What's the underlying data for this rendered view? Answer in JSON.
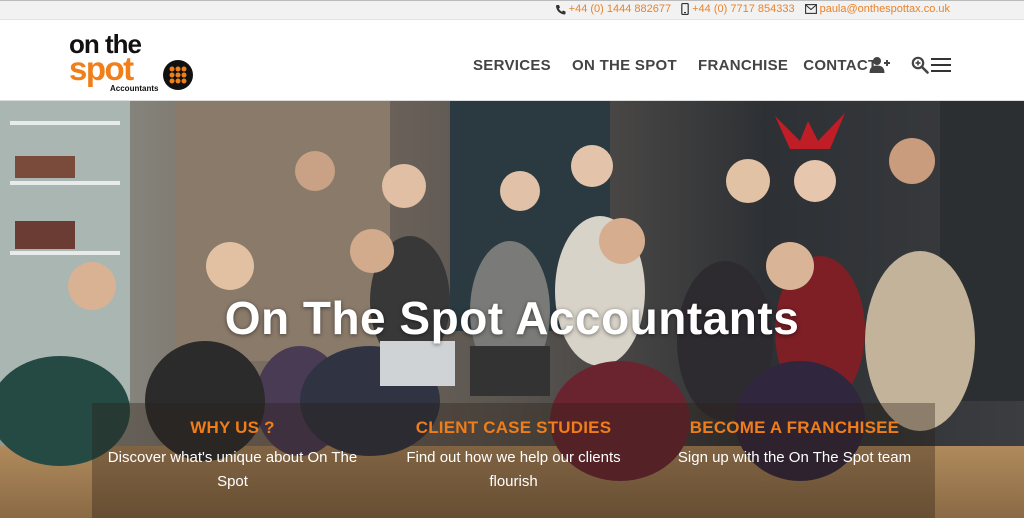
{
  "topbar": {
    "phone1": "+44 (0) 1444 882677",
    "phone2": "+44 (0) 7717 854333",
    "email": "paula@onthespottax.co.uk",
    "accent": "#e8832a"
  },
  "logo": {
    "line1": "on the",
    "line2": "spot",
    "line3": "Accountants",
    "brand_orange": "#f07f1a"
  },
  "nav": {
    "items": [
      "SERVICES",
      "ON THE SPOT",
      "FRANCHISE",
      "CONTACT"
    ],
    "icons": [
      "user-plus-icon",
      "search-zoom-icon",
      "hamburger-menu-icon"
    ]
  },
  "hero": {
    "title": "On The Spot Accountants"
  },
  "cards": [
    {
      "title": "WHY US ?",
      "text": "Discover what's unique about On The Spot"
    },
    {
      "title": "CLIENT CASE STUDIES",
      "text": "Find out how we help our clients flourish"
    },
    {
      "title": "BECOME A FRANCHISEE",
      "text": "Sign up with the On The Spot team"
    }
  ]
}
